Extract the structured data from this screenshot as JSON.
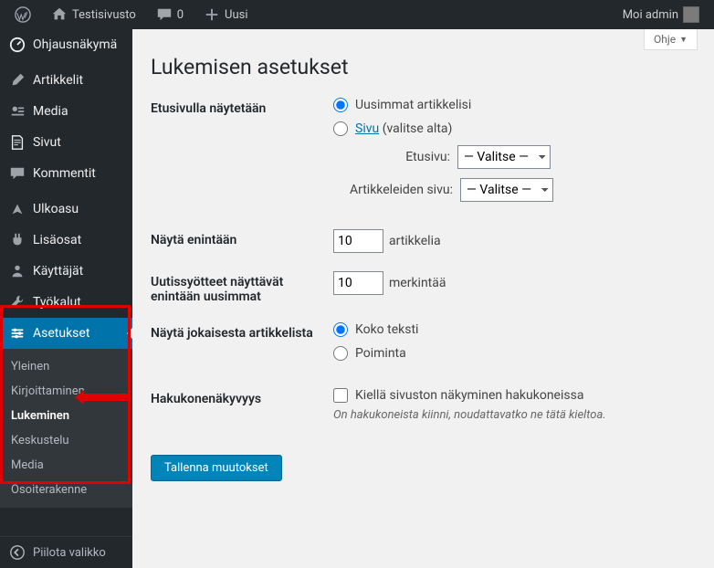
{
  "topbar": {
    "site_name": "Testisivusto",
    "comments_count": "0",
    "new_label": "Uusi",
    "greeting": "Moi admin"
  },
  "sidebar": {
    "dashboard": "Ohjausnäkymä",
    "posts": "Artikkelit",
    "media": "Media",
    "pages": "Sivut",
    "comments": "Kommentit",
    "appearance": "Ulkoasu",
    "plugins": "Lisäosat",
    "users": "Käyttäjät",
    "tools": "Työkalut",
    "settings": "Asetukset",
    "submenu": {
      "general": "Yleinen",
      "writing": "Kirjoittaminen",
      "reading": "Lukeminen",
      "discussion": "Keskustelu",
      "media": "Media",
      "permalinks": "Osoiterakenne"
    },
    "collapse": "Piilota valikko"
  },
  "main": {
    "help": "Ohje",
    "title": "Lukemisen asetukset",
    "front_page": {
      "label": "Etusivulla näytetään",
      "opt_latest": "Uusimmat artikkelisi",
      "opt_page": "Sivu",
      "opt_page_suffix": "(valitse alta)",
      "front_label": "Etusivu:",
      "posts_label": "Artikkeleiden sivu:",
      "select_placeholder": "— Valitse —"
    },
    "posts_max": {
      "label": "Näytä enintään",
      "value": "10",
      "suffix": "artikkelia"
    },
    "feed_max": {
      "label": "Uutissyötteet näyttävät enintään uusimmat",
      "value": "10",
      "suffix": "merkintää"
    },
    "feed_content": {
      "label": "Näytä jokaisesta artikkelista",
      "opt_full": "Koko teksti",
      "opt_excerpt": "Poiminta"
    },
    "visibility": {
      "label": "Hakukonenäkyvyys",
      "checkbox": "Kiellä sivuston näkyminen hakukoneissa",
      "desc": "On hakukoneista kiinni, noudattavatko ne tätä kieltoa."
    },
    "save": "Tallenna muutokset"
  },
  "colors": {
    "accent": "#0073aa",
    "annotation": "#e00000"
  }
}
